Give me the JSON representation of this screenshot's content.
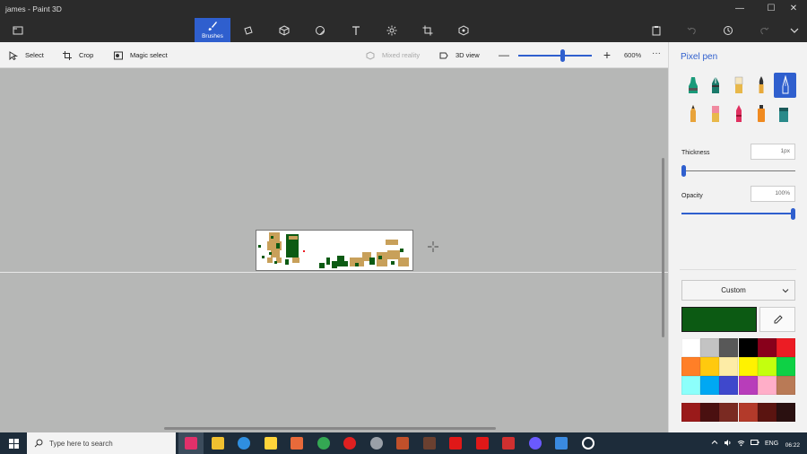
{
  "window": {
    "title": "james - Paint 3D",
    "controls": {
      "minimize": "—",
      "maximize": "☐",
      "close": "✕"
    }
  },
  "toolbar": {
    "tools": [
      {
        "name": "brushes",
        "label": "Brushes",
        "icon": "brush-icon",
        "selected": true
      },
      {
        "name": "2d-shapes",
        "icon": "2d-shapes-icon"
      },
      {
        "name": "3d-shapes",
        "icon": "3d-shapes-icon"
      },
      {
        "name": "stickers",
        "icon": "stickers-icon"
      },
      {
        "name": "text",
        "icon": "text-icon"
      },
      {
        "name": "effects",
        "icon": "effects-icon"
      },
      {
        "name": "canvas",
        "icon": "canvas-icon"
      },
      {
        "name": "3d-library",
        "icon": "3d-library-icon"
      }
    ],
    "right": [
      "paste-icon",
      "undo-icon",
      "history-icon",
      "redo-icon",
      "expand-icon"
    ]
  },
  "commandbar": {
    "select_label": "Select",
    "crop_label": "Crop",
    "magic_select_label": "Magic select",
    "mixed_reality_label": "Mixed reality",
    "view_3d_label": "3D view",
    "zoom_minus": "—",
    "zoom_plus": "+",
    "zoom_level": "600%",
    "more": "···"
  },
  "panel": {
    "title": "Pixel pen",
    "brushes": [
      {
        "name": "marker",
        "color": "#1a9a7a"
      },
      {
        "name": "calligraphy-pen",
        "color": "#1a7a6a"
      },
      {
        "name": "oil-brush",
        "color": "#e8b84a"
      },
      {
        "name": "watercolor",
        "color": "#e8a93a"
      },
      {
        "name": "pixel-pen",
        "color": "#2f5fce",
        "selected": true
      },
      {
        "name": "pencil",
        "color": "#e8a33a"
      },
      {
        "name": "eraser",
        "color": "#f08aa0"
      },
      {
        "name": "crayon",
        "color": "#e03060"
      },
      {
        "name": "spray-can",
        "color": "#f08a20"
      },
      {
        "name": "fill",
        "color": "#2a8a8a"
      }
    ],
    "thickness_label": "Thickness",
    "thickness_value": "1px",
    "thickness_fraction": 0.0,
    "opacity_label": "Opacity",
    "opacity_value": "100%",
    "opacity_fraction": 1.0,
    "color_mode": "Custom",
    "current_color": "#0c5a13",
    "palette": [
      [
        "#ffffff",
        "#c3c3c3",
        "#585858",
        "#000000",
        "#88001b",
        "#ec1c24"
      ],
      [
        "#ff7f27",
        "#ffc90e",
        "#fdeca6",
        "#fff200",
        "#c4ff0e",
        "#0ed145"
      ],
      [
        "#8cfffb",
        "#00a8f3",
        "#3f48cc",
        "#b83dba",
        "#ffaec8",
        "#b97a56"
      ],
      [
        "#9a1a1a",
        "#4a1010",
        "#7a2a22",
        "#b33a2a",
        "#5a1410",
        "#2a1010"
      ]
    ]
  },
  "taskbar": {
    "search_placeholder": "Type here to search",
    "apps": [
      {
        "name": "paint-3d",
        "color": "#e0306a",
        "active": true
      },
      {
        "name": "file-explorer",
        "color": "#f0c030"
      },
      {
        "name": "edge",
        "color": "#2f8fe0"
      },
      {
        "name": "winamp",
        "color": "#ffd43a"
      },
      {
        "name": "photos",
        "color": "#e86a3a"
      },
      {
        "name": "chrome",
        "color": "#34a853"
      },
      {
        "name": "record",
        "color": "#e02020"
      },
      {
        "name": "obs",
        "color": "#9aa0a8"
      },
      {
        "name": "game-app",
        "color": "#c0502a"
      },
      {
        "name": "rpg-app",
        "color": "#6a4030"
      },
      {
        "name": "red-app-1",
        "color": "#e01818"
      },
      {
        "name": "red-app-2",
        "color": "#e01818"
      },
      {
        "name": "mario",
        "color": "#d03030"
      },
      {
        "name": "orb",
        "color": "#6a5aff"
      },
      {
        "name": "blue-app",
        "color": "#3a8ae0"
      },
      {
        "name": "media-player",
        "color": "#ffffff"
      }
    ],
    "language": "ENG",
    "time": "06:22"
  }
}
